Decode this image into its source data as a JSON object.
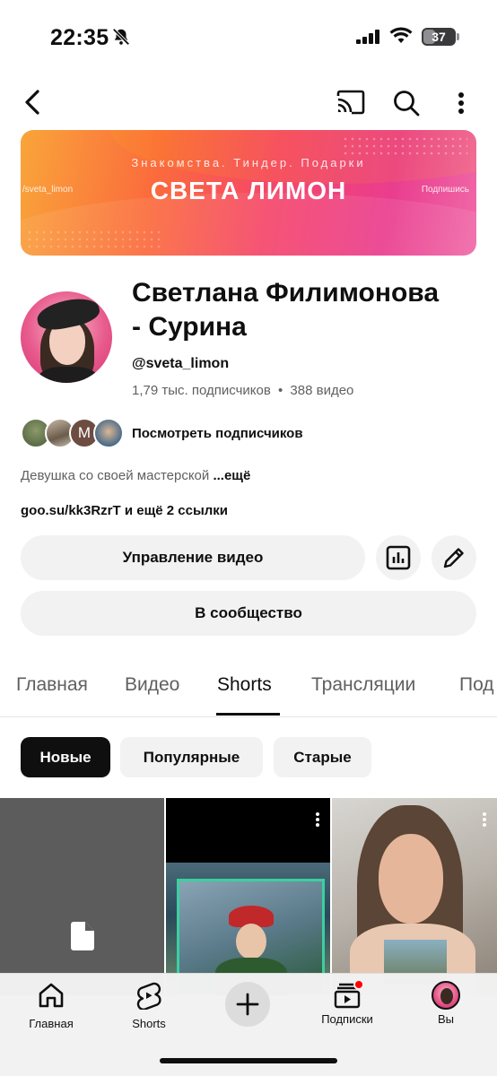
{
  "status_bar": {
    "time": "22:35",
    "battery": "37"
  },
  "banner": {
    "subtitle": "Знакомства. Тиндер. Подарки",
    "title": "СВЕТА ЛИМОН",
    "handle": "/sveta_limon",
    "subscribe": "Подпишись"
  },
  "channel": {
    "name_line1": "Светлана Филимонова",
    "name_line2": "- Сурина",
    "handle": "@sveta_limon",
    "subscribers": "1,79 тыс. подписчиков",
    "separator": "•",
    "videos": "388 видео",
    "view_subscribers": "Посмотреть подписчиков",
    "subscriber_avatar_letter": "M",
    "description": "Девушка со своей мастерской",
    "more": "...ещё",
    "links": "goo.su/kk3RzrT и ещё 2 ссылки"
  },
  "actions": {
    "manage_videos": "Управление видео",
    "community": "В сообщество"
  },
  "tabs": [
    {
      "label": "Главная"
    },
    {
      "label": "Видео"
    },
    {
      "label": "Shorts"
    },
    {
      "label": "Трансляции"
    },
    {
      "label": "Под"
    }
  ],
  "chips": [
    {
      "label": "Новые"
    },
    {
      "label": "Популярные"
    },
    {
      "label": "Старые"
    }
  ],
  "bottom_nav": {
    "home": "Главная",
    "shorts": "Shorts",
    "subscriptions": "Подписки",
    "you": "Вы"
  },
  "colors": {
    "accent": "#ff0000",
    "chip_active_bg": "#0f0f0f",
    "pill_bg": "#f2f2f2",
    "secondary_text": "#606060"
  }
}
